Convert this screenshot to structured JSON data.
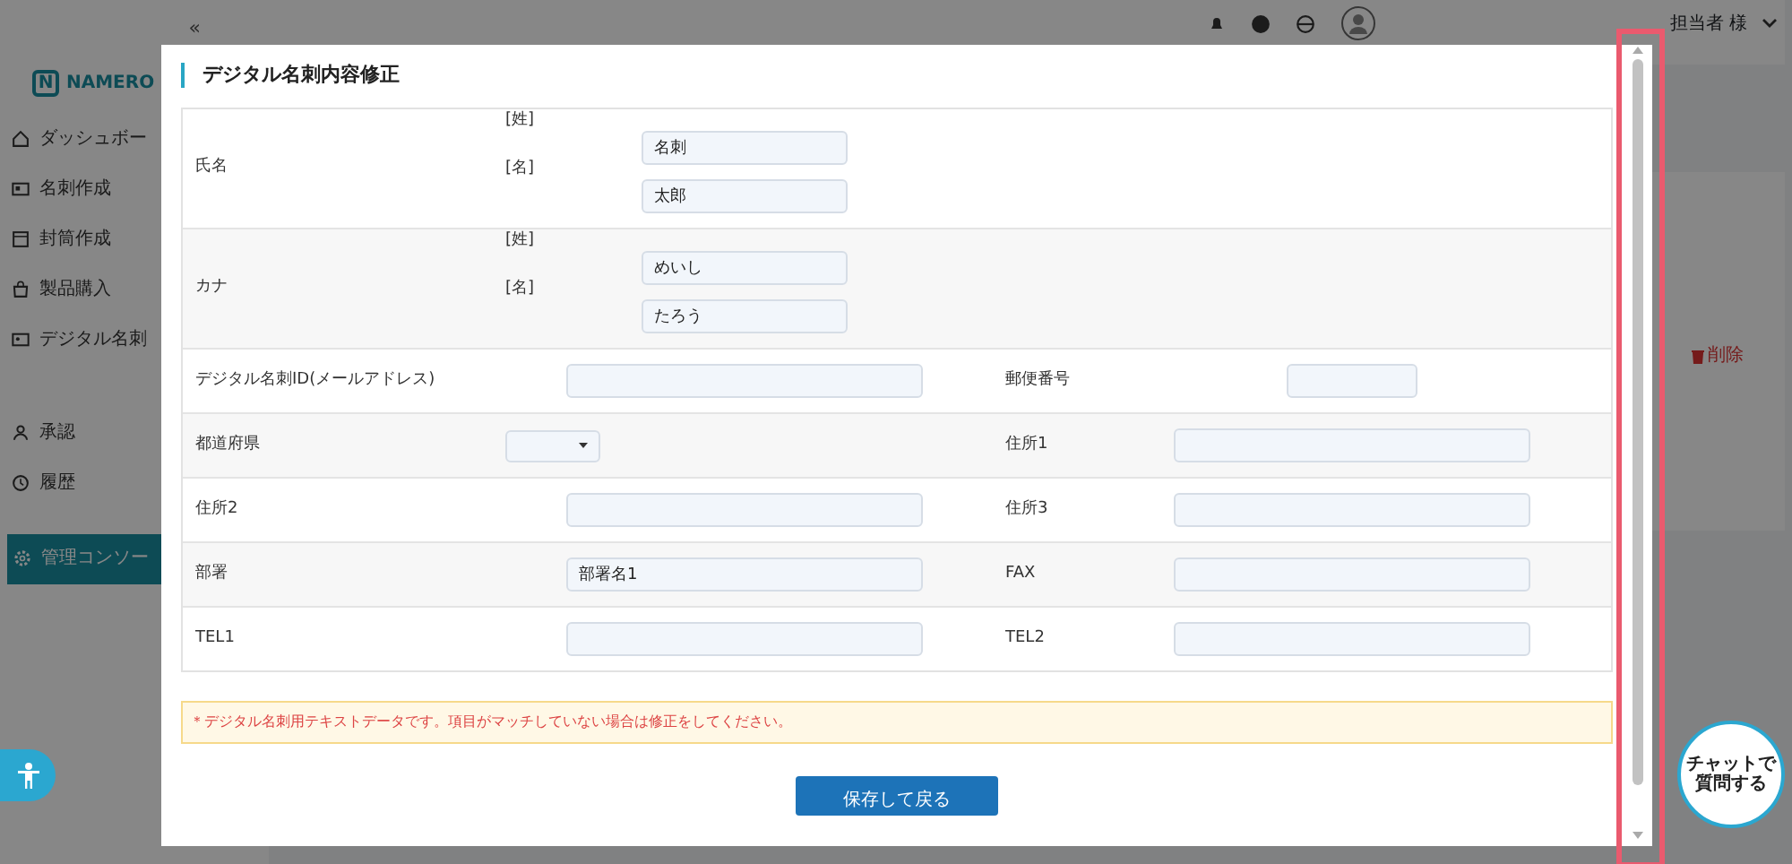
{
  "sidebar": {
    "collapse": "«",
    "logo_mark": "N",
    "logo": "NAMERO",
    "items": [
      {
        "label": "ダッシュボー",
        "selected": false
      },
      {
        "label": "名刺作成",
        "selected": false
      },
      {
        "label": "封筒作成",
        "selected": false
      },
      {
        "label": "製品購入",
        "selected": false
      },
      {
        "label": "デジタル名刺",
        "selected": false
      },
      {
        "label": "承認",
        "selected": false
      },
      {
        "label": "履歴",
        "selected": false
      },
      {
        "label": "管理コンソー",
        "selected": true
      }
    ]
  },
  "header": {
    "user": "担当者 様"
  },
  "background_card": {
    "delete": "削除"
  },
  "modal": {
    "title": "デジタル名刺内容修正",
    "name_rows": [
      {
        "label": "氏名",
        "parts": [
          {
            "sublabel": "[姓]",
            "value": "名刺"
          },
          {
            "sublabel": "[名]",
            "value": "太郎"
          }
        ]
      },
      {
        "label": "カナ",
        "parts": [
          {
            "sublabel": "[姓]",
            "value": "めいし"
          },
          {
            "sublabel": "[名]",
            "value": "たろう"
          }
        ]
      }
    ],
    "rows": [
      {
        "cells": [
          {
            "label": "デジタル名刺ID(メールアドレス)",
            "kind": "text"
          },
          {
            "label": "郵便番号",
            "kind": "short"
          }
        ]
      },
      {
        "cells": [
          {
            "label": "都道府県",
            "kind": "select"
          },
          {
            "label": "住所1",
            "kind": "text"
          }
        ]
      },
      {
        "cells": [
          {
            "label": "住所2",
            "kind": "text"
          },
          {
            "label": "住所3",
            "kind": "text"
          }
        ]
      },
      {
        "cells": [
          {
            "label": "部署",
            "kind": "text",
            "value": "部署名1"
          },
          {
            "label": "FAX",
            "kind": "text"
          }
        ]
      },
      {
        "cells": [
          {
            "label": "TEL1",
            "kind": "text"
          },
          {
            "label": "TEL2",
            "kind": "text"
          }
        ]
      }
    ],
    "notice": "＊デジタル名刺用テキストデータです。項目がマッチしていない場合は修正をしてください。",
    "save": "保存して戻る"
  },
  "chat_button": [
    "チャットで",
    "質問する"
  ]
}
